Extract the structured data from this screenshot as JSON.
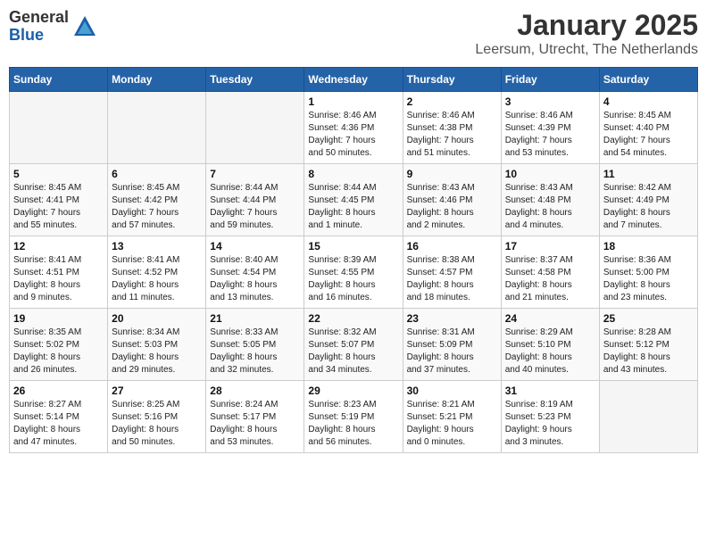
{
  "logo": {
    "general": "General",
    "blue": "Blue"
  },
  "title": "January 2025",
  "subtitle": "Leersum, Utrecht, The Netherlands",
  "days_of_week": [
    "Sunday",
    "Monday",
    "Tuesday",
    "Wednesday",
    "Thursday",
    "Friday",
    "Saturday"
  ],
  "weeks": [
    [
      {
        "day": "",
        "info": ""
      },
      {
        "day": "",
        "info": ""
      },
      {
        "day": "",
        "info": ""
      },
      {
        "day": "1",
        "info": "Sunrise: 8:46 AM\nSunset: 4:36 PM\nDaylight: 7 hours\nand 50 minutes."
      },
      {
        "day": "2",
        "info": "Sunrise: 8:46 AM\nSunset: 4:38 PM\nDaylight: 7 hours\nand 51 minutes."
      },
      {
        "day": "3",
        "info": "Sunrise: 8:46 AM\nSunset: 4:39 PM\nDaylight: 7 hours\nand 53 minutes."
      },
      {
        "day": "4",
        "info": "Sunrise: 8:45 AM\nSunset: 4:40 PM\nDaylight: 7 hours\nand 54 minutes."
      }
    ],
    [
      {
        "day": "5",
        "info": "Sunrise: 8:45 AM\nSunset: 4:41 PM\nDaylight: 7 hours\nand 55 minutes."
      },
      {
        "day": "6",
        "info": "Sunrise: 8:45 AM\nSunset: 4:42 PM\nDaylight: 7 hours\nand 57 minutes."
      },
      {
        "day": "7",
        "info": "Sunrise: 8:44 AM\nSunset: 4:44 PM\nDaylight: 7 hours\nand 59 minutes."
      },
      {
        "day": "8",
        "info": "Sunrise: 8:44 AM\nSunset: 4:45 PM\nDaylight: 8 hours\nand 1 minute."
      },
      {
        "day": "9",
        "info": "Sunrise: 8:43 AM\nSunset: 4:46 PM\nDaylight: 8 hours\nand 2 minutes."
      },
      {
        "day": "10",
        "info": "Sunrise: 8:43 AM\nSunset: 4:48 PM\nDaylight: 8 hours\nand 4 minutes."
      },
      {
        "day": "11",
        "info": "Sunrise: 8:42 AM\nSunset: 4:49 PM\nDaylight: 8 hours\nand 7 minutes."
      }
    ],
    [
      {
        "day": "12",
        "info": "Sunrise: 8:41 AM\nSunset: 4:51 PM\nDaylight: 8 hours\nand 9 minutes."
      },
      {
        "day": "13",
        "info": "Sunrise: 8:41 AM\nSunset: 4:52 PM\nDaylight: 8 hours\nand 11 minutes."
      },
      {
        "day": "14",
        "info": "Sunrise: 8:40 AM\nSunset: 4:54 PM\nDaylight: 8 hours\nand 13 minutes."
      },
      {
        "day": "15",
        "info": "Sunrise: 8:39 AM\nSunset: 4:55 PM\nDaylight: 8 hours\nand 16 minutes."
      },
      {
        "day": "16",
        "info": "Sunrise: 8:38 AM\nSunset: 4:57 PM\nDaylight: 8 hours\nand 18 minutes."
      },
      {
        "day": "17",
        "info": "Sunrise: 8:37 AM\nSunset: 4:58 PM\nDaylight: 8 hours\nand 21 minutes."
      },
      {
        "day": "18",
        "info": "Sunrise: 8:36 AM\nSunset: 5:00 PM\nDaylight: 8 hours\nand 23 minutes."
      }
    ],
    [
      {
        "day": "19",
        "info": "Sunrise: 8:35 AM\nSunset: 5:02 PM\nDaylight: 8 hours\nand 26 minutes."
      },
      {
        "day": "20",
        "info": "Sunrise: 8:34 AM\nSunset: 5:03 PM\nDaylight: 8 hours\nand 29 minutes."
      },
      {
        "day": "21",
        "info": "Sunrise: 8:33 AM\nSunset: 5:05 PM\nDaylight: 8 hours\nand 32 minutes."
      },
      {
        "day": "22",
        "info": "Sunrise: 8:32 AM\nSunset: 5:07 PM\nDaylight: 8 hours\nand 34 minutes."
      },
      {
        "day": "23",
        "info": "Sunrise: 8:31 AM\nSunset: 5:09 PM\nDaylight: 8 hours\nand 37 minutes."
      },
      {
        "day": "24",
        "info": "Sunrise: 8:29 AM\nSunset: 5:10 PM\nDaylight: 8 hours\nand 40 minutes."
      },
      {
        "day": "25",
        "info": "Sunrise: 8:28 AM\nSunset: 5:12 PM\nDaylight: 8 hours\nand 43 minutes."
      }
    ],
    [
      {
        "day": "26",
        "info": "Sunrise: 8:27 AM\nSunset: 5:14 PM\nDaylight: 8 hours\nand 47 minutes."
      },
      {
        "day": "27",
        "info": "Sunrise: 8:25 AM\nSunset: 5:16 PM\nDaylight: 8 hours\nand 50 minutes."
      },
      {
        "day": "28",
        "info": "Sunrise: 8:24 AM\nSunset: 5:17 PM\nDaylight: 8 hours\nand 53 minutes."
      },
      {
        "day": "29",
        "info": "Sunrise: 8:23 AM\nSunset: 5:19 PM\nDaylight: 8 hours\nand 56 minutes."
      },
      {
        "day": "30",
        "info": "Sunrise: 8:21 AM\nSunset: 5:21 PM\nDaylight: 9 hours\nand 0 minutes."
      },
      {
        "day": "31",
        "info": "Sunrise: 8:19 AM\nSunset: 5:23 PM\nDaylight: 9 hours\nand 3 minutes."
      },
      {
        "day": "",
        "info": ""
      }
    ]
  ]
}
